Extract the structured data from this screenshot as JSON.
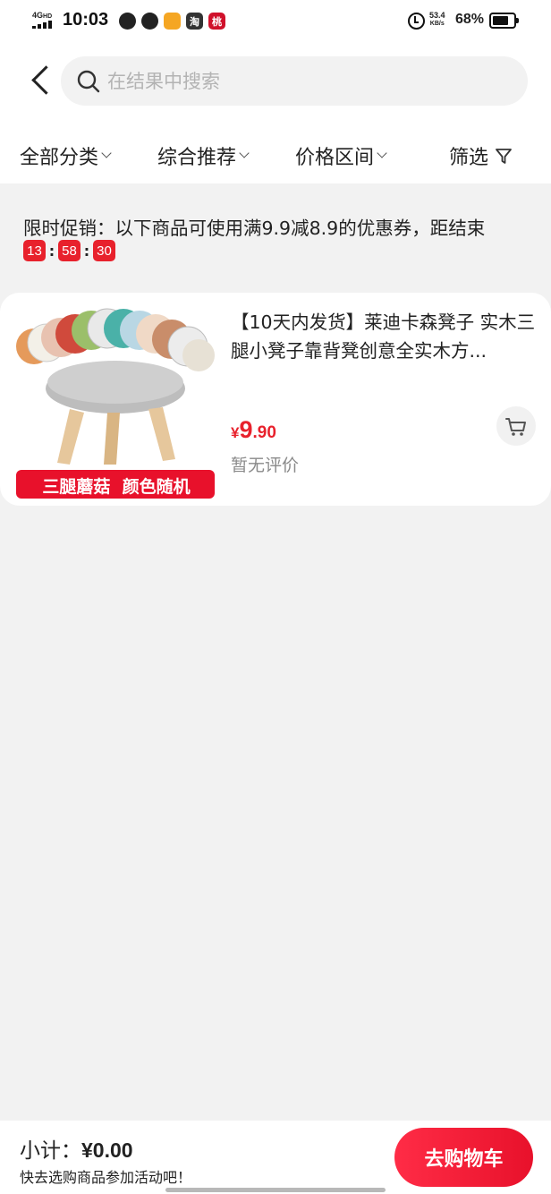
{
  "status_bar": {
    "network": "4G",
    "hd": "HD",
    "time": "10:03",
    "net_speed_value": "53.4",
    "net_speed_unit": "KB/s",
    "battery_percent": "68%",
    "app_icons": [
      "taobao-icon",
      "shop-icon"
    ],
    "app_labels": [
      "淘",
      "桃"
    ]
  },
  "search": {
    "placeholder": "在结果中搜索",
    "value": ""
  },
  "filters": {
    "all_categories": "全部分类",
    "recommend": "综合推荐",
    "price_range": "价格区间",
    "filter": "筛选"
  },
  "promo": {
    "text": "限时促销：以下商品可使用满9.9减8.9的优惠券，距结束",
    "hours": "13",
    "minutes": "58",
    "seconds": "30"
  },
  "product": {
    "title": "【10天内发货】莱迪卡森凳子 实木三腿小凳子靠背凳创意全实木方...",
    "image_banner": "三腿蘑菇  颜色随机",
    "price_symbol": "¥",
    "price_int": "9",
    "price_dec": ".90",
    "review": "暂无评价"
  },
  "footer": {
    "subtotal_label": "小计：",
    "subtotal_value": "¥0.00",
    "hint": "快去选购商品参加活动吧！",
    "go_cart": "去购物车"
  },
  "colors": {
    "accent": "#e8212c",
    "background": "#f2f2f2"
  }
}
